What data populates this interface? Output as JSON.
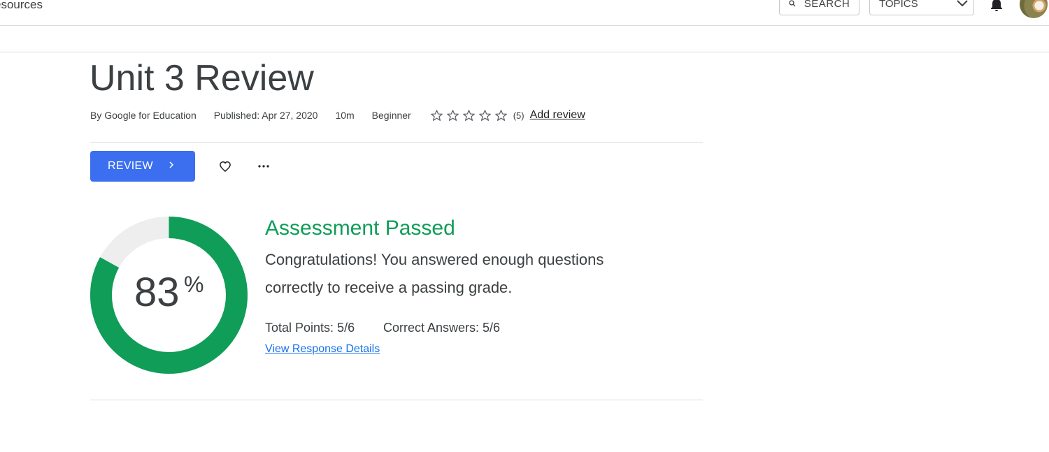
{
  "header": {
    "site_link": "esources",
    "search_label": "SEARCH",
    "topics_label": "TOPICS",
    "icons": [
      "search-icon",
      "chevron-down-icon",
      "bell-icon",
      "avatar"
    ]
  },
  "course": {
    "title": "Unit 3 Review",
    "author": "By Google for Education",
    "published": "Published: Apr 27, 2020",
    "duration": "10m",
    "level": "Beginner",
    "rating_count": "(5)",
    "add_review": "Add review"
  },
  "actions": {
    "review_label": "REVIEW",
    "icons": [
      "chevron-right-icon",
      "heart-icon",
      "more-icon"
    ]
  },
  "result": {
    "percent": "83",
    "percent_sign": "%",
    "score_fraction": 0.83,
    "title": "Assessment Passed",
    "message": "Congratulations! You answered enough questions correctly to receive a passing grade.",
    "total_points": "Total Points: 5/6",
    "correct_answers": "Correct Answers: 5/6",
    "details_link": "View Response Details"
  },
  "colors": {
    "accent_blue": "#3b6ff0",
    "pass_green": "#0f9d58",
    "ring_track": "#eeeeee",
    "link_blue": "#1a73e8"
  }
}
